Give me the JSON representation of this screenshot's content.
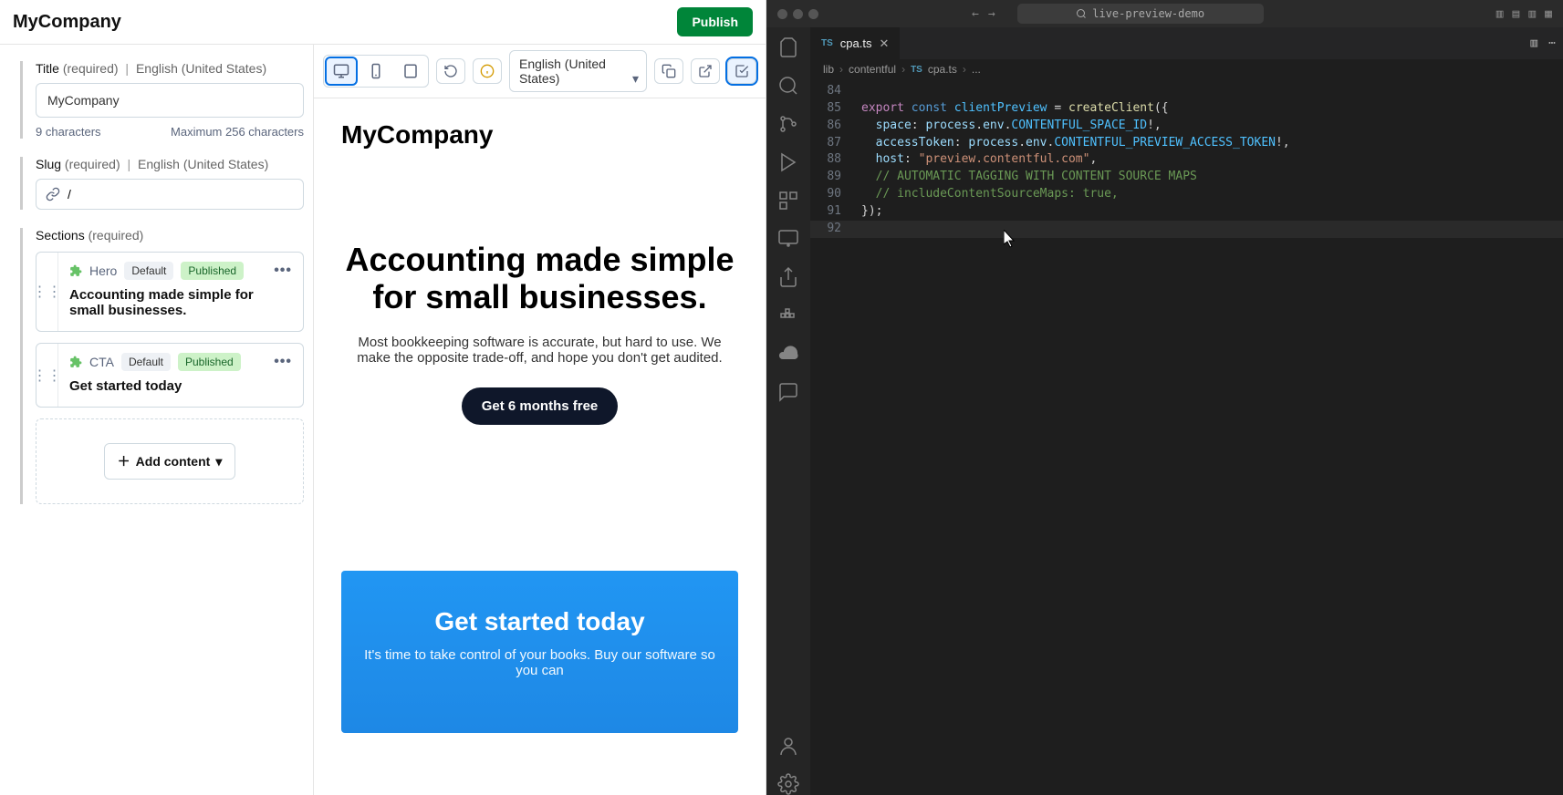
{
  "cms": {
    "page_title": "MyCompany",
    "publish_label": "Publish",
    "fields": {
      "title": {
        "label": "Title",
        "required": "(required)",
        "locale": "English (United States)",
        "value": "MyCompany",
        "count": "9 characters",
        "max": "Maximum 256 characters"
      },
      "slug": {
        "label": "Slug",
        "required": "(required)",
        "locale": "English (United States)",
        "value": "/"
      },
      "sections": {
        "label": "Sections",
        "required": "(required)",
        "items": [
          {
            "type": "Hero",
            "variant": "Default",
            "status": "Published",
            "title": "Accounting made simple for small businesses."
          },
          {
            "type": "CTA",
            "variant": "Default",
            "status": "Published",
            "title": "Get started today"
          }
        ]
      }
    },
    "add_content_label": "Add content"
  },
  "preview": {
    "toolbar": {
      "locale": "English (United States)"
    },
    "brand": "MyCompany",
    "hero_heading": "Accounting made simple for small businesses.",
    "hero_sub": "Most bookkeeping software is accurate, but hard to use. We make the opposite trade-off, and hope you don't get audited.",
    "hero_cta": "Get 6 months free",
    "cta_heading": "Get started today",
    "cta_sub": "It's time to take control of your books. Buy our software so you can"
  },
  "vscode": {
    "search": "live-preview-demo",
    "tab_name": "cpa.ts",
    "breadcrumbs": [
      "lib",
      "contentful",
      "cpa.ts",
      "..."
    ],
    "lines": [
      {
        "n": "84",
        "html": ""
      },
      {
        "n": "85",
        "html": "<span class='kw'>export</span> <span class='kw2'>const</span> <span class='const'>clientPreview</span> <span class='op'>=</span> <span class='fn'>createClient</span>({"
      },
      {
        "n": "86",
        "html": "  <span class='var'>space</span>: <span class='var'>process</span>.<span class='var'>env</span>.<span class='const'>CONTENTFUL_SPACE_ID</span>!,"
      },
      {
        "n": "87",
        "html": "  <span class='var'>accessToken</span>: <span class='var'>process</span>.<span class='var'>env</span>.<span class='const'>CONTENTFUL_PREVIEW_ACCESS_TOKEN</span>!,"
      },
      {
        "n": "88",
        "html": "  <span class='var'>host</span>: <span class='str'>\"preview.contentful.com\"</span>,"
      },
      {
        "n": "89",
        "html": "  <span class='cm'>// AUTOMATIC TAGGING WITH CONTENT SOURCE MAPS</span>"
      },
      {
        "n": "90",
        "html": "  <span class='cm'>// includeContentSourceMaps: true,</span>"
      },
      {
        "n": "91",
        "html": "});"
      },
      {
        "n": "92",
        "html": "",
        "cur": true
      }
    ]
  }
}
